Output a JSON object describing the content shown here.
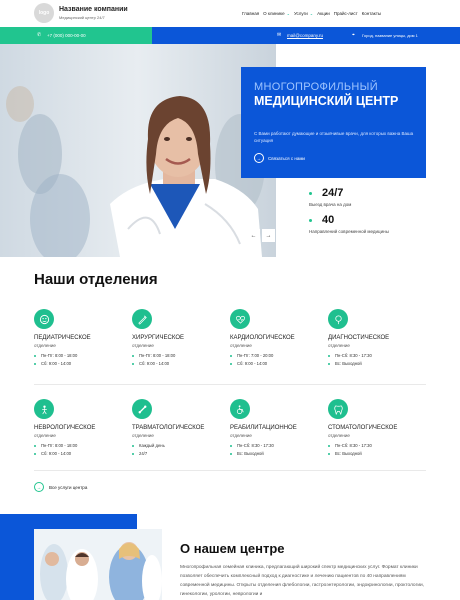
{
  "header": {
    "logo_text": "logo",
    "company_name": "Название компании",
    "tagline": "Медицинский центр 24/7",
    "nav": [
      {
        "label": "Главная",
        "has_dropdown": false
      },
      {
        "label": "О клинике",
        "has_dropdown": true
      },
      {
        "label": "Услуги",
        "has_dropdown": true
      },
      {
        "label": "Акции",
        "has_dropdown": false
      },
      {
        "label": "Прайс-лист",
        "has_dropdown": false
      },
      {
        "label": "Контакты",
        "has_dropdown": false
      }
    ]
  },
  "contact_bar": {
    "phone": "+7 (000) 000-00-00",
    "email": "mail@company.ru",
    "address": "Город, название улицы, дом 1",
    "colors": {
      "green": "#21c58f",
      "blue": "#0b56d8"
    }
  },
  "hero": {
    "eyebrow": "МНОГОПРОФИЛЬНЫЙ",
    "title": "МЕДИЦИНСКИЙ ЦЕНТР",
    "text": "С Вами работают думающие и отзывчивые врачи, для которых важна Ваша ситуация",
    "cta": "Связаться с нами",
    "prev": "←",
    "next": "→"
  },
  "stats": [
    {
      "value": "24/7",
      "label": "Выезд врача на дом"
    },
    {
      "value": "40",
      "label": "Направлений современной медицины"
    }
  ],
  "departments": {
    "title": "Наши отделения",
    "items": [
      {
        "name": "ПЕДИАТРИЧЕСКОЕ",
        "sub": "отделение",
        "hours": [
          "Пн-Пт: 8:00 - 18:00",
          "Сб: 9:00 - 14:00"
        ],
        "icon": "pediatric-icon"
      },
      {
        "name": "ХИРУРГИЧЕСКОЕ",
        "sub": "отделение",
        "hours": [
          "Пн-Пт: 8:00 - 18:00",
          "Сб: 9:00 - 14:00"
        ],
        "icon": "surgery-icon"
      },
      {
        "name": "КАРДИОЛОГИЧЕСКОЕ",
        "sub": "отделение",
        "hours": [
          "Пн-Пт: 7:00 - 20:00",
          "Сб: 9:00 - 14:00"
        ],
        "icon": "cardiology-icon"
      },
      {
        "name": "ДИАГНОСТИЧЕСКОЕ",
        "sub": "отделение",
        "hours": [
          "Пн-Сб: 8:30 - 17:30",
          "Вс: Выходной"
        ],
        "icon": "diagnostic-icon"
      },
      {
        "name": "НЕВРОЛОГИЧЕСКОЕ",
        "sub": "отделение",
        "hours": [
          "Пн-Пт: 8:00 - 18:00",
          "Сб: 9:00 - 14:00"
        ],
        "icon": "neurology-icon"
      },
      {
        "name": "ТРАВМАТОЛОГИЧЕСКОЕ",
        "sub": "отделение",
        "hours": [
          "Каждый день",
          "24/7"
        ],
        "icon": "trauma-icon"
      },
      {
        "name": "РЕАБИЛИТАЦИОННОЕ",
        "sub": "отделение",
        "hours": [
          "Пн-Сб: 8:30 - 17:30",
          "Вс: Выходной"
        ],
        "icon": "rehab-icon"
      },
      {
        "name": "СТОМАТОЛОГИЧЕСКОЕ",
        "sub": "отделение",
        "hours": [
          "Пн-Сб: 8:30 - 17:30",
          "Вс: Выходной"
        ],
        "icon": "dental-icon"
      }
    ],
    "all_link": "Все услуги центра"
  },
  "about": {
    "title": "О нашем центре",
    "text": "Многопрофильная семейная клиника, предлагающий широкий спектр медицинских услуг. Формат клиники позволяет обеспечить комплексный подход к диагностике и лечению пациентов по 40 направлениям современной медицины. Открыты отделения флебологии, гастроэнтерологии, эндокринологии, проктологии, гинекологии, урологии, неврологии и"
  }
}
